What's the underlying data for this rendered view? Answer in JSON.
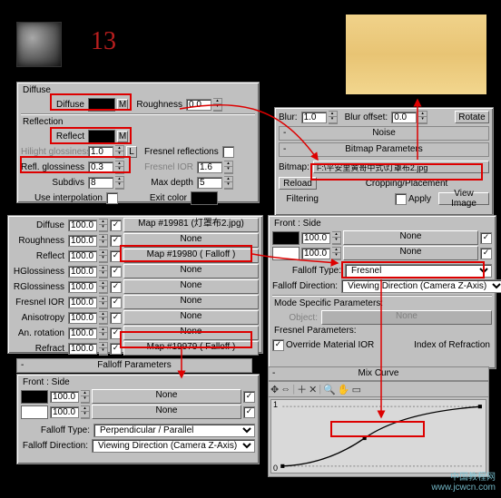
{
  "annotation": "13",
  "diffuse_panel": {
    "title": "Diffuse",
    "diffuse_label": "Diffuse",
    "m_button": "M",
    "roughness_label": "Roughness",
    "roughness_value": "0.0",
    "reflection_title": "Reflection",
    "reflect_label": "Reflect",
    "hilight_gloss_label": "Hilight glossiness",
    "hilight_gloss_value": "1.0",
    "refl_gloss_label": "Refl. glossiness",
    "refl_gloss_value": "0.3",
    "subdivs_label": "Subdivs",
    "subdivs_value": "8",
    "interp_label": "Use interpolation",
    "l_button": "L",
    "fresnel_refl_label": "Fresnel reflections",
    "fresnel_ior_label": "Fresnel IOR",
    "fresnel_ior_value": "1.6",
    "maxdepth_label": "Max depth",
    "maxdepth_value": "5",
    "exit_label": "Exit color"
  },
  "maps_panel": {
    "rows": [
      {
        "label": "Diffuse",
        "val": "100.0",
        "map": "Map #19981 (灯罩布2.jpg)"
      },
      {
        "label": "Roughness",
        "val": "100.0",
        "map": "None"
      },
      {
        "label": "Reflect",
        "val": "100.0",
        "map": "Map #19980  ( Falloff )"
      },
      {
        "label": "HGlossiness",
        "val": "100.0",
        "map": "None"
      },
      {
        "label": "RGlossiness",
        "val": "100.0",
        "map": "None"
      },
      {
        "label": "Fresnel IOR",
        "val": "100.0",
        "map": "None"
      },
      {
        "label": "Anisotropy",
        "val": "100.0",
        "map": "None"
      },
      {
        "label": "An. rotation",
        "val": "100.0",
        "map": "None"
      },
      {
        "label": "Refract",
        "val": "100.0",
        "map": "Map #19979  ( Falloff )"
      }
    ]
  },
  "falloff1": {
    "header": "Falloff Parameters",
    "front_side": "Front : Side",
    "v1": "100.0",
    "map1": "None",
    "v2": "100.0",
    "map2": "None",
    "type_label": "Falloff Type:",
    "type_value": "Perpendicular / Parallel",
    "dir_label": "Falloff Direction:",
    "dir_value": "Viewing Direction (Camera Z-Axis)"
  },
  "bitmap_panel": {
    "blur_label": "Blur:",
    "blur_value": "1.0",
    "blur_off_label": "Blur offset:",
    "blur_off_value": "0.0",
    "rotate": "Rotate",
    "noise_header": "Noise",
    "bitmap_header": "Bitmap Parameters",
    "bitmap_label": "Bitmap:",
    "bitmap_path": "F:\\平安里黄哥中式\\灯罩布2.jpg",
    "reload": "Reload",
    "crop_title": "Cropping/Placement",
    "apply": "Apply",
    "view": "View Image",
    "filtering": "Filtering"
  },
  "falloff2": {
    "front_side": "Front : Side",
    "v1": "100.0",
    "map1": "None",
    "v2": "100.0",
    "map2": "None",
    "type_label": "Falloff Type:",
    "type_value": "Fresnel",
    "dir_label": "Falloff Direction:",
    "dir_value": "Viewing Direction (Camera Z-Axis)",
    "mode_title": "Mode Specific Parameters:",
    "object_label": "Object:",
    "object_value": "None",
    "fp_title": "Fresnel Parameters:",
    "override": "Override Material IOR",
    "ior_label": "Index of Refraction"
  },
  "mixcurve": {
    "header": "Mix Curve",
    "ymax": "1",
    "ymin": "0"
  },
  "watermark": {
    "l1": "中国教程网",
    "l2": "www.jcwcn.com"
  }
}
